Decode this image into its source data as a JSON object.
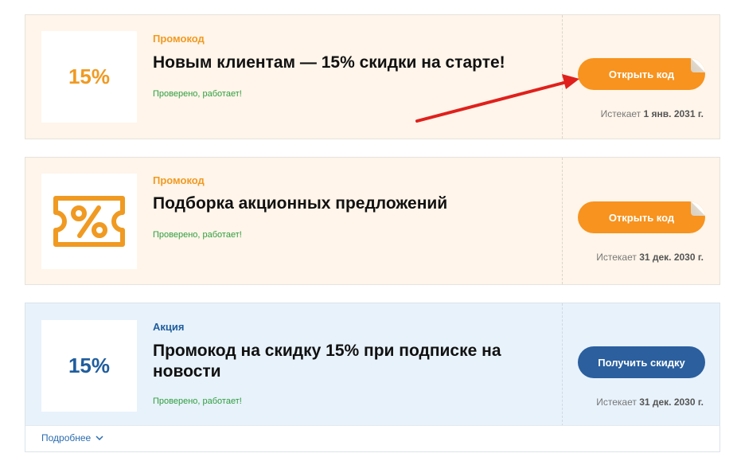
{
  "offers": [
    {
      "thumb_text": "15%",
      "type_label": "Промокод",
      "title": "Новым клиентам — 15% скидки на старте!",
      "verified": "Проверено, работает!",
      "button_label": "Открыть код",
      "expires_prefix": "Истекает",
      "expires_date": "1 янв. 2031 г."
    },
    {
      "thumb_icon": "ticket-percent-icon",
      "type_label": "Промокод",
      "title": "Подборка акционных предложений",
      "verified": "Проверено, работает!",
      "button_label": "Открыть код",
      "expires_prefix": "Истекает",
      "expires_date": "31 дек. 2030 г."
    },
    {
      "thumb_text": "15%",
      "type_label": "Акция",
      "title": "Промокод на скидку 15% при подписке на новости",
      "verified": "Проверено, работает!",
      "button_label": "Получить скидку",
      "expires_prefix": "Истекает",
      "expires_date": "31 дек. 2030 г.",
      "more_label": "Подробнее"
    }
  ],
  "colors": {
    "promo_accent": "#f09a22",
    "promo_button": "#f7931e",
    "deal_accent": "#1f5d9d",
    "deal_button": "#2b5f9e",
    "verified_green": "#2e9e3e",
    "annotation_arrow": "#e0201c"
  }
}
